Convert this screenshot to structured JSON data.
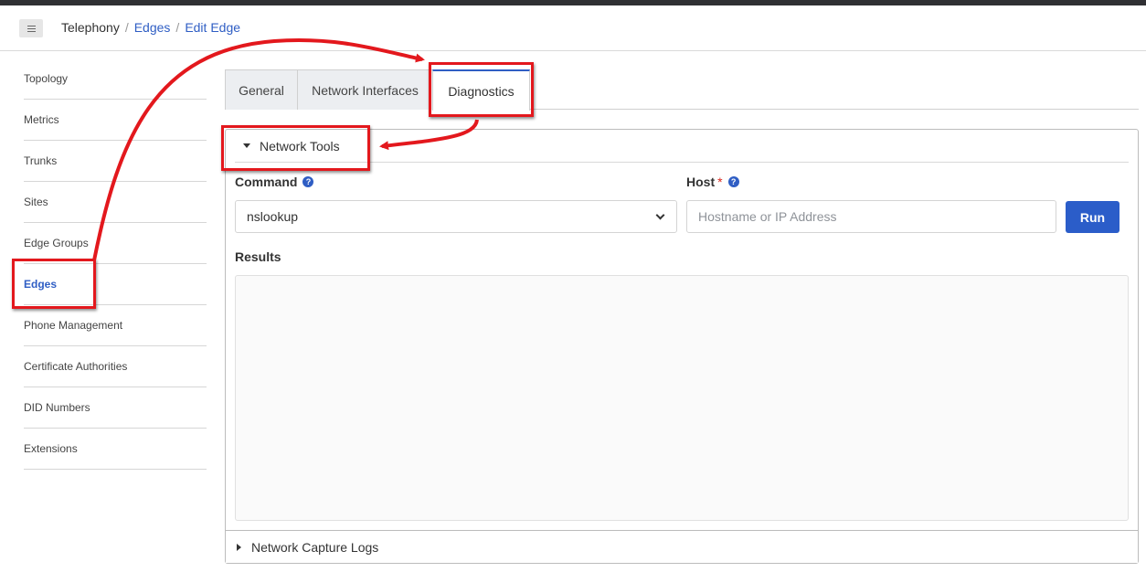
{
  "breadcrumb": {
    "items": [
      "Telephony",
      "Edges",
      "Edit Edge"
    ],
    "separator": "/"
  },
  "sidebar": {
    "items": [
      {
        "label": "Topology"
      },
      {
        "label": "Metrics"
      },
      {
        "label": "Trunks"
      },
      {
        "label": "Sites"
      },
      {
        "label": "Edge Groups"
      },
      {
        "label": "Edges",
        "active": true
      },
      {
        "label": "Phone Management"
      },
      {
        "label": "Certificate Authorities"
      },
      {
        "label": "DID Numbers"
      },
      {
        "label": "Extensions"
      }
    ]
  },
  "tabs": [
    {
      "label": "General"
    },
    {
      "label": "Network Interfaces"
    },
    {
      "label": "Diagnostics",
      "active": true
    }
  ],
  "network_tools": {
    "title": "Network Tools",
    "command_label": "Command",
    "command_value": "nslookup",
    "host_label": "Host",
    "host_required_mark": "*",
    "host_placeholder": "Hostname or IP Address",
    "help_glyph": "?",
    "run_label": "Run",
    "results_label": "Results"
  },
  "network_capture_logs": {
    "title": "Network Capture Logs"
  },
  "colors": {
    "accent": "#2f5ec4",
    "annotation": "#e3181d",
    "required": "#d9271d"
  }
}
